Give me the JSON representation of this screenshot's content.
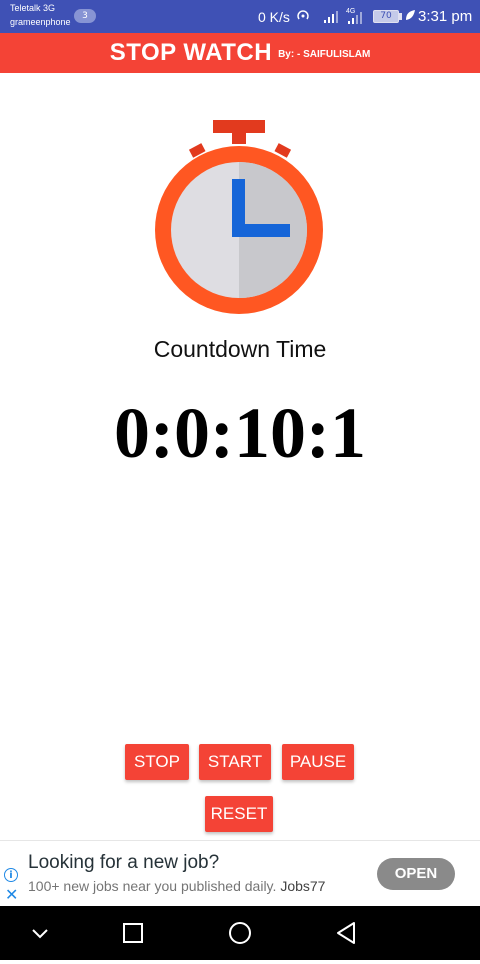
{
  "status_bar": {
    "carrier_1": "Teletalk 3G",
    "carrier_2": "grameenphone",
    "notification_count": "3",
    "net_speed": "0 K/s",
    "network_type": "4G",
    "battery": "70",
    "time": "3:31 pm",
    "bg_color": "#3f51b5"
  },
  "app_bar": {
    "title": "STOP WATCH",
    "subtitle": "By: - SAIFULISLAM",
    "bg_color": "#f44336"
  },
  "main": {
    "stopwatch_icon": "stopwatch-icon",
    "label": "Countdown Time",
    "time": "0:0:10:1"
  },
  "controls": {
    "stop_label": "STOP",
    "start_label": "START",
    "pause_label": "PAUSE",
    "reset_label": "RESET",
    "button_color": "#f44336"
  },
  "ad": {
    "title": "Looking for a new job?",
    "body": "100+ new jobs near you published daily.",
    "brand": "Jobs77",
    "cta": "OPEN",
    "info_icon": "info-icon",
    "close_icon": "close-icon"
  },
  "nav_bar": {
    "icons": [
      "chevron-down-icon",
      "recents-icon",
      "home-icon",
      "back-icon"
    ]
  }
}
